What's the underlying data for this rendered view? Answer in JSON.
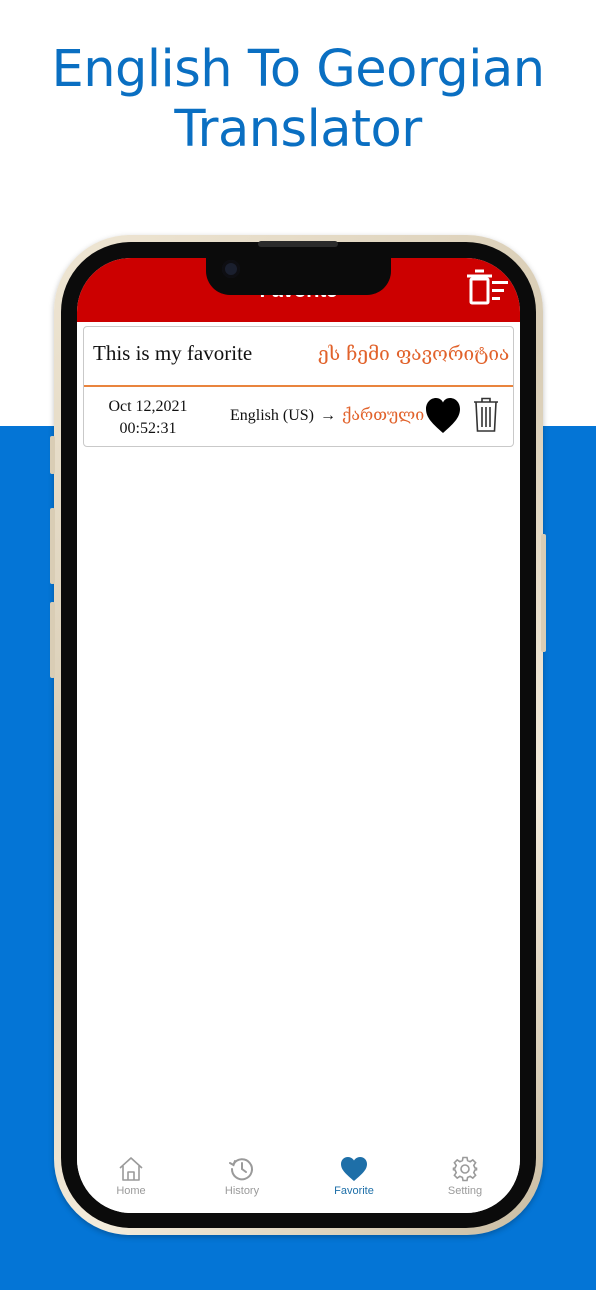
{
  "headline": {
    "line1": "English To Georgian",
    "line2": "Translator"
  },
  "topbar": {
    "title": "Favorite"
  },
  "favorites": [
    {
      "source_text": "This is my favorite",
      "translated_text": "ეს ჩემი ფავორიტია",
      "date": "Oct 12,2021",
      "time": "00:52:31",
      "source_lang": "English (US)",
      "arrow": "→",
      "target_lang": "ქართული"
    }
  ],
  "nav": {
    "items": [
      {
        "label": "Home",
        "icon": "home-icon"
      },
      {
        "label": "History",
        "icon": "history-icon"
      },
      {
        "label": "Favorite",
        "icon": "heart-icon",
        "active": true
      },
      {
        "label": "Setting",
        "icon": "gear-icon"
      }
    ]
  },
  "colors": {
    "background_band": "#0475d6",
    "headline": "#0a6fc2",
    "topbar": "#cc0000",
    "accent": "#e1622b",
    "active_nav": "#1e6fa8",
    "inactive_nav": "#9a9a9a"
  }
}
